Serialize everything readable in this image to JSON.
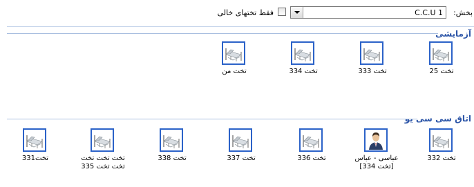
{
  "toolbar": {
    "ward_label": "بخش:",
    "ward_value": "C.C.U 1",
    "empty_only_label": "فقط تختهای خالی"
  },
  "sections": [
    {
      "title": "آزمایشی",
      "beds": [
        {
          "label": "تخت 25",
          "occupied": false
        },
        {
          "label": "تخت 333",
          "occupied": false
        },
        {
          "label": "تخت 334",
          "occupied": false
        },
        {
          "label": "تخت من",
          "occupied": false
        }
      ]
    },
    {
      "title": "اتاق سی سی یو",
      "beds": [
        {
          "label": "تخت 332",
          "occupied": false
        },
        {
          "label": "عباسی - عباس",
          "label2": "[تخت 334]",
          "occupied": true
        },
        {
          "label": "تخت 336",
          "occupied": false
        },
        {
          "label": "تخت 337",
          "occupied": false
        },
        {
          "label": "تخت 338",
          "occupied": false
        },
        {
          "label": "تخت تخت تخت",
          "label2": "تخت تخت 335",
          "occupied": false
        },
        {
          "label": "تخت331",
          "occupied": false
        }
      ]
    }
  ],
  "colors": {
    "accent": "#2d56a8",
    "bed_border": "#2b62c8"
  },
  "icons": {
    "bed": "hospital-bed-icon",
    "patient": "patient-avatar-icon",
    "dropdown": "chevron-down-icon"
  }
}
